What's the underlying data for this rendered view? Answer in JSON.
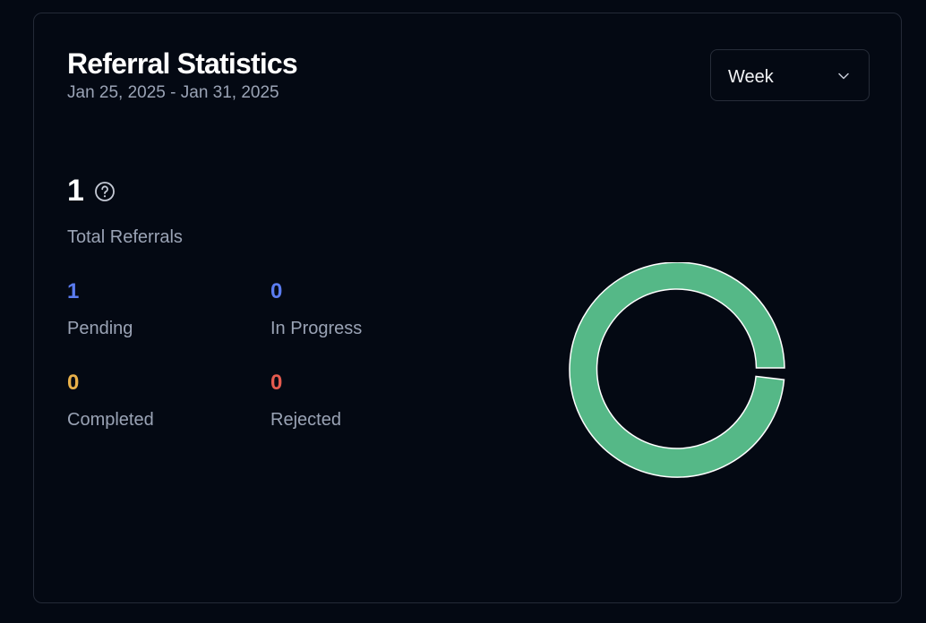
{
  "header": {
    "title": "Referral Statistics",
    "date_range": "Jan 25, 2025 - Jan 31, 2025"
  },
  "period_select": {
    "value": "Week",
    "icon": "chevron-down-icon"
  },
  "total": {
    "value": "1",
    "label": "Total Referrals",
    "icon": "help-circle-icon"
  },
  "stats": {
    "pending": {
      "value": "1",
      "label": "Pending",
      "color": "#5b7cf0"
    },
    "in_progress": {
      "value": "0",
      "label": "In Progress",
      "color": "#5b7cf0"
    },
    "completed": {
      "value": "0",
      "label": "Completed",
      "color": "#e8b04a"
    },
    "rejected": {
      "value": "0",
      "label": "Rejected",
      "color": "#e55b4f"
    }
  },
  "colors": {
    "background": "#040913",
    "donut_fill": "#55b887",
    "donut_stroke": "#ffffff"
  }
}
